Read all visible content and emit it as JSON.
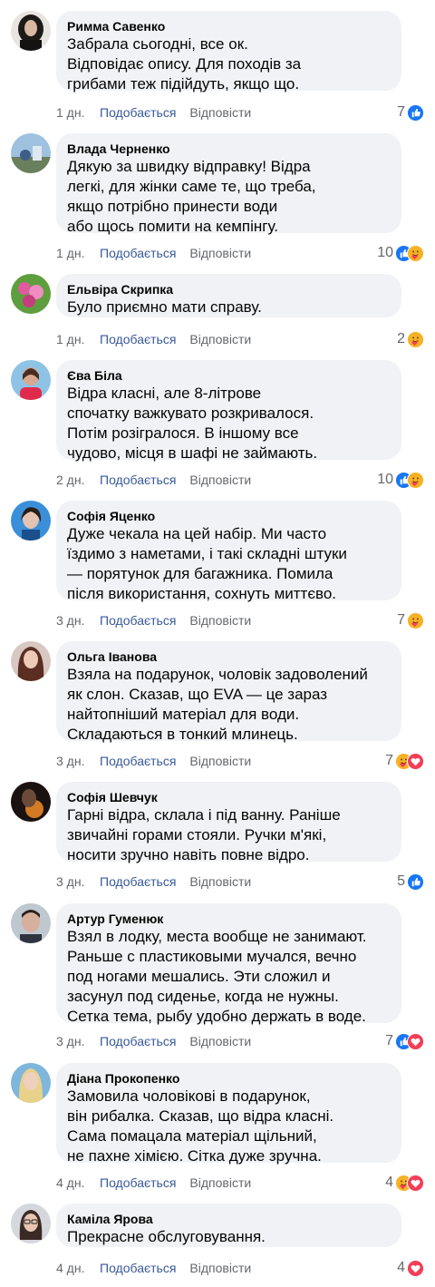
{
  "actions": {
    "like": "Подобається",
    "reply": "Відповісти"
  },
  "colors": {
    "bubble": "#f0f2f5",
    "like_link": "#385898",
    "meta": "#65676b",
    "like_blue": "#1877f2",
    "heart_red": "#f33e58",
    "care_yellow": "#f7b125"
  },
  "comments": [
    {
      "author": "Римма Савенко",
      "text": "Забрала сьогодні, все ок.\nВідповідає опису. Для походів за\nгрибами теж підійдуть, якщо що.",
      "time": "1 дн.",
      "count": "7",
      "reactions": [
        "like-icon"
      ],
      "avatar": "avatar-woman-dark-hair"
    },
    {
      "author": "Влада Черненко",
      "text": "Дякую за швидку відправку! Відра\nлегкі, для жінки саме те, що треба,\nякщо потрібно принести води\nабо щось помити на кемпінгу.",
      "time": "1 дн.",
      "count": "10",
      "reactions": [
        "like-icon",
        "care-icon"
      ],
      "avatar": "avatar-outdoor-photo"
    },
    {
      "author": "Ельвіра Скрипка",
      "text": "Було приємно мати справу.",
      "time": "1 дн.",
      "count": "2",
      "reactions": [
        "care-icon"
      ],
      "avatar": "avatar-flowers"
    },
    {
      "author": "Єва Біла",
      "text": "Відра класні, але 8-літрове\nспочатку важкувато розкривалося.\nПотім розігралося. В іншому все\nчудово, місця в шафі не займають.",
      "time": "2 дн.",
      "count": "10",
      "reactions": [
        "like-icon",
        "care-icon"
      ],
      "avatar": "avatar-woman-red-top"
    },
    {
      "author": "Софія Яценко",
      "text": "Дуже чекала на цей набір. Ми часто\nїздимо з наметами, і такі складні штуки\n— порятунок для багажника. Помила\nпісля використання, сохнуть миттєво.",
      "time": "3 дн.",
      "count": "7",
      "reactions": [
        "care-icon"
      ],
      "avatar": "avatar-woman-blue"
    },
    {
      "author": "Ольга Іванова",
      "text": "Взяла на подарунок, чоловік задоволений\nяк слон. Сказав, що EVA — це зараз\nнайтопніший матеріал для води.\nСкладаються в тонкий млинець.",
      "time": "3 дн.",
      "count": "7",
      "reactions": [
        "care-icon",
        "love-icon"
      ],
      "avatar": "avatar-woman-long-hair"
    },
    {
      "author": "Софія Шевчук",
      "text": "Гарні відра, склала і під ванну. Раніше\nзвичайні горами стояли. Ручки м'які,\nносити зручно навіть повне відро.",
      "time": "3 дн.",
      "count": "5",
      "reactions": [
        "like-icon"
      ],
      "avatar": "avatar-dark-warm"
    },
    {
      "author": "Артур Гуменюк",
      "text": "Взял в лодку, места вообще не занимают.\nРаньше с пластиковыми мучался, вечно\nпод ногами мешались. Эти сложил и\nзасунул под сиденье, когда не нужны.\nСетка тема, рыбу удобно держать в воде.",
      "time": "3 дн.",
      "count": "7",
      "reactions": [
        "like-icon",
        "love-icon"
      ],
      "avatar": "avatar-man-portrait"
    },
    {
      "author": "Діана Прокопенко",
      "text": "Замовила чоловікові в подарунок,\nвін рибалка. Сказав, що відра класні.\nСама помацала матеріал щільний,\nне пахне хімією. Сітка дуже зручна.",
      "time": "4 дн.",
      "count": "4",
      "reactions": [
        "care-icon",
        "love-icon"
      ],
      "avatar": "avatar-woman-blonde"
    },
    {
      "author": "Каміла Ярова",
      "text": "Прекрасне обслуговування.",
      "time": "4 дн.",
      "count": "4",
      "reactions": [
        "love-icon"
      ],
      "avatar": "avatar-woman-glasses"
    }
  ]
}
